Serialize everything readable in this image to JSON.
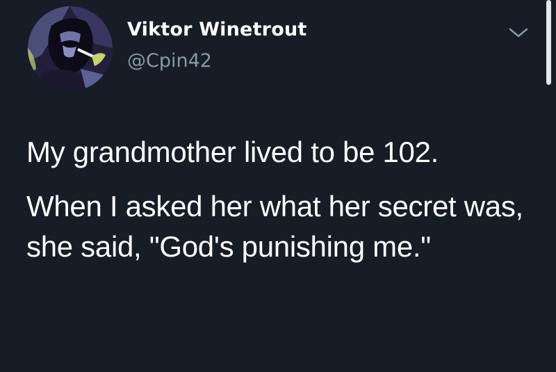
{
  "tweet": {
    "author": {
      "display_name": "Viktor Winetrout",
      "handle": "@Cpin42"
    },
    "paragraphs": [
      "My grandmother lived to be 102.",
      "When I asked her what her secret was, she said, \"God's punishing me.\""
    ]
  },
  "icons": {
    "avatar": "avatar-icon",
    "caret": "chevron-down-icon"
  },
  "colors": {
    "background": "#161d27",
    "text": "#ffffff",
    "handle": "#8899a6",
    "caret": "#8899a6"
  }
}
